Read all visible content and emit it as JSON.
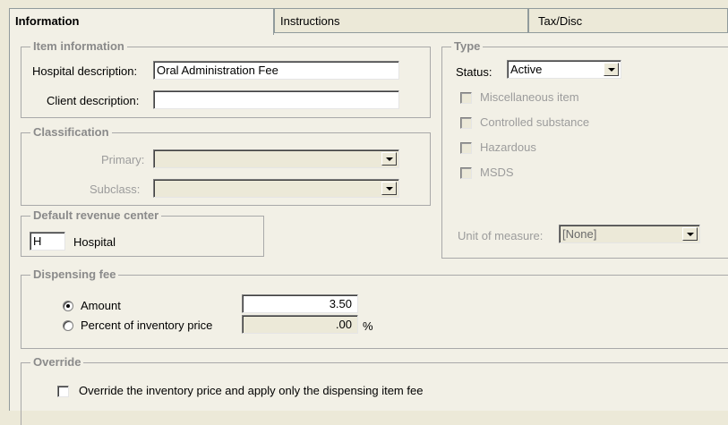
{
  "tabs": [
    "Information",
    "Instructions",
    "Tax/Disc"
  ],
  "item_info": {
    "legend": "Item information",
    "hospital_desc_label": "Hospital description:",
    "hospital_desc_value": "Oral Administration Fee",
    "client_desc_label": "Client description:",
    "client_desc_value": ""
  },
  "classification": {
    "legend": "Classification",
    "primary_label": "Primary:",
    "primary_value": "",
    "subclass_label": "Subclass:",
    "subclass_value": ""
  },
  "revenue": {
    "legend": "Default revenue center",
    "code": "H",
    "name": "Hospital"
  },
  "type": {
    "legend": "Type",
    "status_label": "Status:",
    "status_value": "Active",
    "checkboxes": [
      "Miscellaneous item",
      "Controlled substance",
      "Hazardous",
      "MSDS"
    ],
    "uom_label": "Unit of measure:",
    "uom_value": "[None]"
  },
  "dispensing": {
    "legend": "Dispensing fee",
    "amount_label": "Amount",
    "amount_value": "3.50",
    "amount_selected": true,
    "percent_label": "Percent of inventory price",
    "percent_value": ".00",
    "percent_suffix": "%"
  },
  "override": {
    "legend": "Override",
    "checkbox_label": "Override the inventory price and apply only the dispensing item fee"
  }
}
